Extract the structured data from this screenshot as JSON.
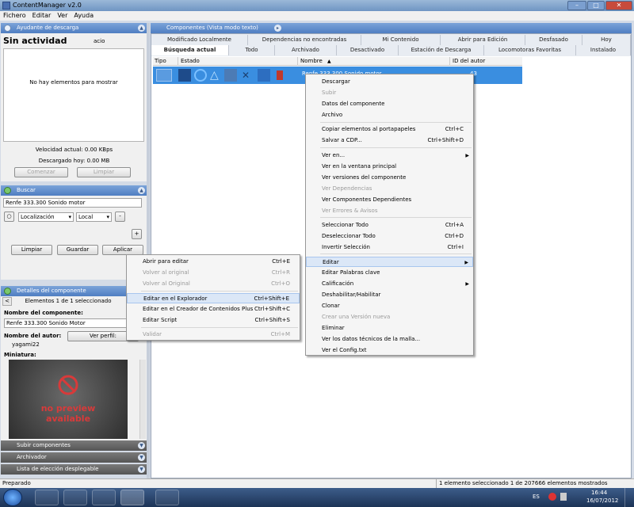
{
  "window": {
    "title": "ContentManager v2.0",
    "min": "–",
    "max": "□",
    "close": "✕"
  },
  "menubar": [
    "Fichero",
    "Editar",
    "Ver",
    "Ayuda"
  ],
  "download_panel": {
    "header": "Ayudante de descarga",
    "status": "Sin actividad",
    "status_extra": "acio",
    "empty": "No hay elementos para mostrar",
    "speed": "Velocidad actual: 0.00 KBps",
    "downloaded": "Descargado hoy: 0.00 MB",
    "start": "Comenzar",
    "clear": "Limpiar"
  },
  "search_panel": {
    "header": "Buscar",
    "query": "Renfe 333.300 Sonido motor",
    "location": "Localización",
    "scope": "Local",
    "minus": "-",
    "plus": "+",
    "clear": "Limpiar",
    "save": "Guardar",
    "apply": "Aplicar"
  },
  "details_panel": {
    "header": "Detalles del componente",
    "nav_prev": "<",
    "selection": "Elementos 1 de 1 seleccionado",
    "name_label": "Nombre del componente:",
    "name_value": "Renfe 333.300 Sonido Motor",
    "author_label": "Nombre del autor:",
    "profile_btn": "Ver perfil:",
    "author_value": "yagami22",
    "thumb_label": "Miniatura:",
    "no_preview_1": "no preview",
    "no_preview_2": "available"
  },
  "bottom_panels": [
    "Subir componentes",
    "Archivador",
    "Lista de elección desplegable"
  ],
  "components": {
    "header": "Componentes (Vista modo texto)",
    "tabs_row1": [
      "Modificado Localmente",
      "Dependencias no encontradas",
      "Mi Contenido",
      "Abrir para Edición",
      "Desfasado",
      "Hoy"
    ],
    "tabs_row2": [
      "Búsqueda actual",
      "Todo",
      "Archivado",
      "Desactivado",
      "Estación de Descarga",
      "Locomotoras Favoritas",
      "Instalado"
    ],
    "columns": [
      "Tipo",
      "Estado",
      "Nombre",
      "ID del autor"
    ],
    "row_name": "Renfe 333.300 Sonido motor",
    "row_author": "43"
  },
  "context_menu": [
    {
      "label": "Descargar",
      "shortcut": "",
      "disabled": false
    },
    {
      "label": "Subir",
      "shortcut": "",
      "disabled": true
    },
    {
      "label": "Datos del componente",
      "shortcut": "",
      "disabled": false
    },
    {
      "label": "Archivo",
      "shortcut": "",
      "disabled": false
    },
    {
      "label": "Copiar elementos al portapapeles",
      "shortcut": "Ctrl+C",
      "disabled": false
    },
    {
      "label": "Salvar a CDP...",
      "shortcut": "Ctrl+Shift+D",
      "disabled": false
    },
    {
      "label": "Ver en...",
      "shortcut": "",
      "disabled": false,
      "submenu": true
    },
    {
      "label": "Ver en la ventana principal",
      "shortcut": "",
      "disabled": false
    },
    {
      "label": "Ver versiones del componente",
      "shortcut": "",
      "disabled": false
    },
    {
      "label": "Ver Dependencias",
      "shortcut": "",
      "disabled": true
    },
    {
      "label": "Ver Componentes Dependientes",
      "shortcut": "",
      "disabled": false
    },
    {
      "label": "Ver Errores & Avisos",
      "shortcut": "",
      "disabled": true
    },
    {
      "label": "Seleccionar Todo",
      "shortcut": "Ctrl+A",
      "disabled": false
    },
    {
      "label": "Deseleccionar Todo",
      "shortcut": "Ctrl+D",
      "disabled": false
    },
    {
      "label": "Invertir Selección",
      "shortcut": "Ctrl+I",
      "disabled": false
    },
    {
      "label": "Editar",
      "shortcut": "",
      "disabled": false,
      "submenu": true,
      "highlight": true
    },
    {
      "label": "Editar Palabras clave",
      "shortcut": "",
      "disabled": false
    },
    {
      "label": "Calificación",
      "shortcut": "",
      "disabled": false,
      "submenu": true
    },
    {
      "label": "Deshabilitar/Habilitar",
      "shortcut": "",
      "disabled": false
    },
    {
      "label": "Clonar",
      "shortcut": "",
      "disabled": false
    },
    {
      "label": "Crear una Versión nueva",
      "shortcut": "",
      "disabled": true
    },
    {
      "label": "Eliminar",
      "shortcut": "",
      "disabled": false
    },
    {
      "label": "Ver los datos técnicos de la malla...",
      "shortcut": "",
      "disabled": false
    },
    {
      "label": "Ver el Config.txt",
      "shortcut": "",
      "disabled": false
    }
  ],
  "edit_submenu": [
    {
      "label": "Abrir para editar",
      "shortcut": "Ctrl+E",
      "disabled": false
    },
    {
      "label": "Volver al original",
      "shortcut": "Ctrl+R",
      "disabled": true
    },
    {
      "label": "Volver al Original",
      "shortcut": "Ctrl+O",
      "disabled": true
    },
    {
      "label": "Editar en el Explorador",
      "shortcut": "Ctrl+Shift+E",
      "disabled": false,
      "highlight": true
    },
    {
      "label": "Editar en el Creador de Contenidos Plus",
      "shortcut": "Ctrl+Shift+C",
      "disabled": false
    },
    {
      "label": "Editar Script",
      "shortcut": "Ctrl+Shift+S",
      "disabled": false
    },
    {
      "label": "Validar",
      "shortcut": "Ctrl+M",
      "disabled": true
    }
  ],
  "status": {
    "left": "Preparado",
    "right": "1 elemento seleccionado 1 de 207666 elementos mostrados"
  },
  "taskbar": {
    "time": "16:44",
    "date": "16/07/2012",
    "lang": "ES"
  }
}
